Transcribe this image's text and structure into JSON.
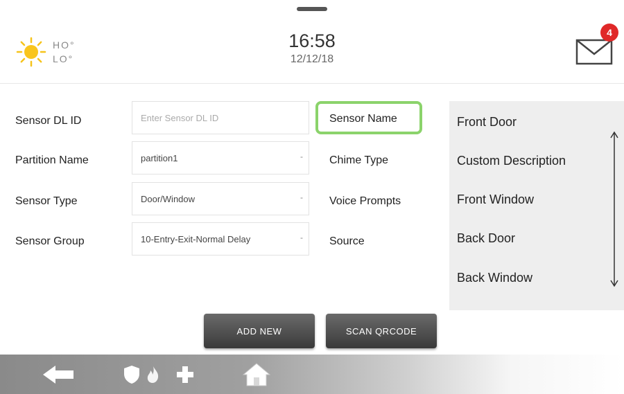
{
  "header": {
    "weather": {
      "hi": "HO°",
      "lo": "LO°",
      "icon": "sun-icon"
    },
    "time": "16:58",
    "date": "12/12/18",
    "mail": {
      "icon": "envelope-icon",
      "unread_count": "4",
      "badge_color": "#e02828"
    }
  },
  "form": {
    "rows": [
      {
        "label": "Sensor DL ID",
        "value": "",
        "placeholder": "Enter Sensor DL ID",
        "has_dropdown": false
      },
      {
        "label": "Partition Name",
        "value": "partition1",
        "has_dropdown": true
      },
      {
        "label": "Sensor Type",
        "value": "Door/Window",
        "has_dropdown": true
      },
      {
        "label": "Sensor Group",
        "value": "10-Entry-Exit-Normal Delay",
        "has_dropdown": true
      }
    ],
    "right_labels": [
      "Sensor Name",
      "Chime Type",
      "Voice Prompts",
      "Source"
    ],
    "highlight_color": "#8bd36b",
    "dropdown_glyph": "-"
  },
  "name_list": {
    "items": [
      "Front Door",
      "Custom Description",
      "Front Window",
      "Back Door",
      "Back Window"
    ],
    "icon": "up-down-arrow-icon"
  },
  "buttons": {
    "add_new": "ADD NEW",
    "scan_qrcode": "SCAN QRCODE"
  },
  "nav": {
    "icons": [
      "back-arrow-icon",
      "shield-icon",
      "fire-icon",
      "plus-icon",
      "home-icon"
    ]
  }
}
